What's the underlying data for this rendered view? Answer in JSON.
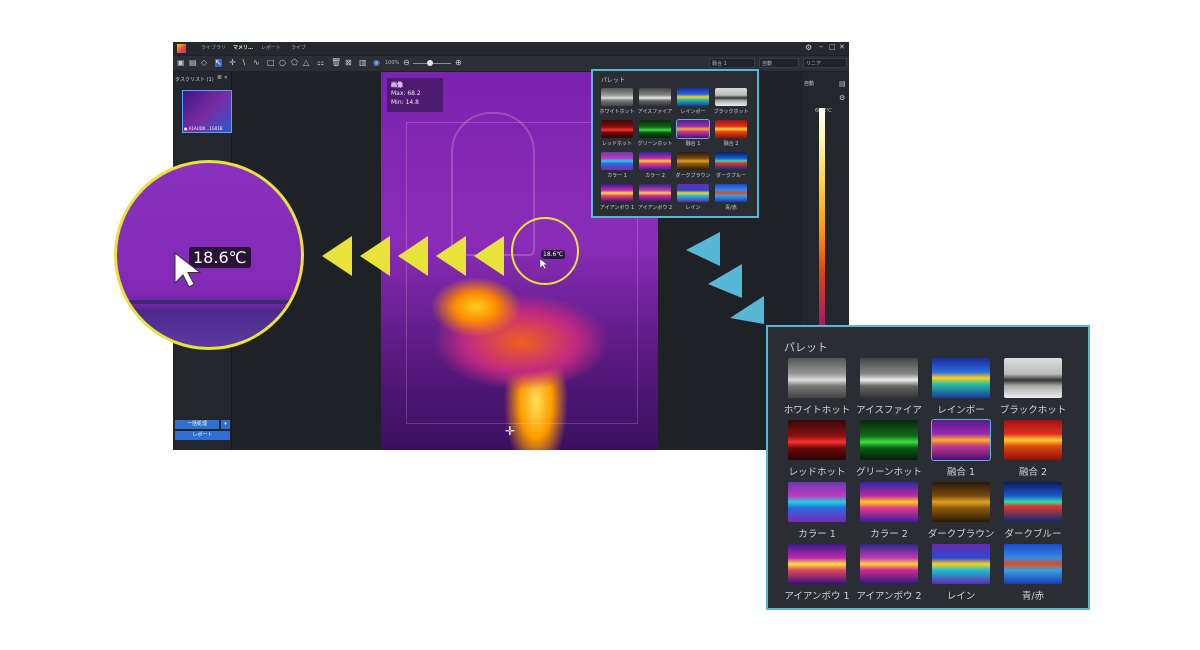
{
  "app": {
    "menu": [
      "ライブラリ",
      "マメリ…",
      "レポート",
      "ライブ"
    ],
    "toolbar_zoom": "100%",
    "palette_select": "融合 1",
    "mode_select": "自動",
    "scale_select": "リニア",
    "task_list_label": "タスクリスト (1)",
    "thumb_caption": "● A1AUD0...1G01B",
    "bottom_btn_1": "一括処理",
    "bottom_btn_2": "レポート",
    "right_label_auto": "自動",
    "right_max": "68.2℃"
  },
  "image_info": {
    "title": "画像",
    "max": "Max: 68.2",
    "min": "Min: 14.8"
  },
  "measurement": {
    "temp_small": "18.6℃",
    "temp_large": "18.6℃"
  },
  "palette": {
    "title": "パレット",
    "selected": "融合 1",
    "items": [
      {
        "label": "ホワイトホット",
        "name": "white-hot"
      },
      {
        "label": "アイスファイア",
        "name": "ice-fire"
      },
      {
        "label": "レインボー",
        "name": "rainbow"
      },
      {
        "label": "ブラックホット",
        "name": "black-hot"
      },
      {
        "label": "レッドホット",
        "name": "red-hot"
      },
      {
        "label": "グリーンホット",
        "name": "green-hot"
      },
      {
        "label": "融合 1",
        "name": "fusion-1"
      },
      {
        "label": "融合 2",
        "name": "fusion-2"
      },
      {
        "label": "カラー 1",
        "name": "color-1"
      },
      {
        "label": "カラー 2",
        "name": "color-2"
      },
      {
        "label": "ダークブラウン",
        "name": "dark-brown"
      },
      {
        "label": "ダークブルー",
        "name": "dark-blue"
      },
      {
        "label": "アイアンボウ 1",
        "name": "ironbow-1"
      },
      {
        "label": "アイアンボウ 2",
        "name": "ironbow-2"
      },
      {
        "label": "レイン",
        "name": "rain"
      },
      {
        "label": "青/赤",
        "name": "blue-red"
      }
    ]
  },
  "colors": {
    "accent_yellow": "#e8e33a",
    "accent_cyan": "#57b7d6",
    "panel_bg": "#2a2d33"
  }
}
